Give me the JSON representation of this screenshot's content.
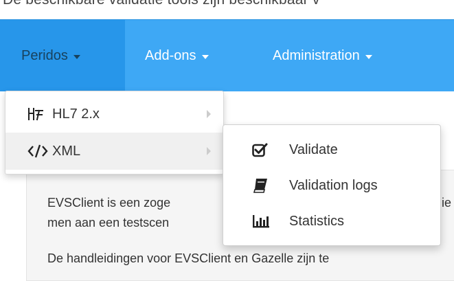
{
  "page_top_text": "De beschikbare validatie tools zijn beschikbaar v",
  "navbar": {
    "items": [
      {
        "label": "Peridos",
        "active": true
      },
      {
        "label": "Add-ons"
      },
      {
        "label": "Administration"
      }
    ],
    "background_color": "#3ea8f5"
  },
  "dropdown": {
    "items": [
      {
        "label": "HL7 2.x",
        "icon": "hl7-icon"
      },
      {
        "label": "XML",
        "icon": "code-icon"
      }
    ]
  },
  "submenu": {
    "items": [
      {
        "label": "Validate",
        "icon": "check-square-icon"
      },
      {
        "label": "Validation logs",
        "icon": "book-icon"
      },
      {
        "label": "Statistics",
        "icon": "bar-chart-icon"
      }
    ]
  },
  "content": {
    "line1": "EVSClient is een zoge",
    "line1_right": "lie",
    "line2": "men aan een testscen",
    "line3": "De handleidingen voor EVSClient en Gazelle zijn te"
  }
}
